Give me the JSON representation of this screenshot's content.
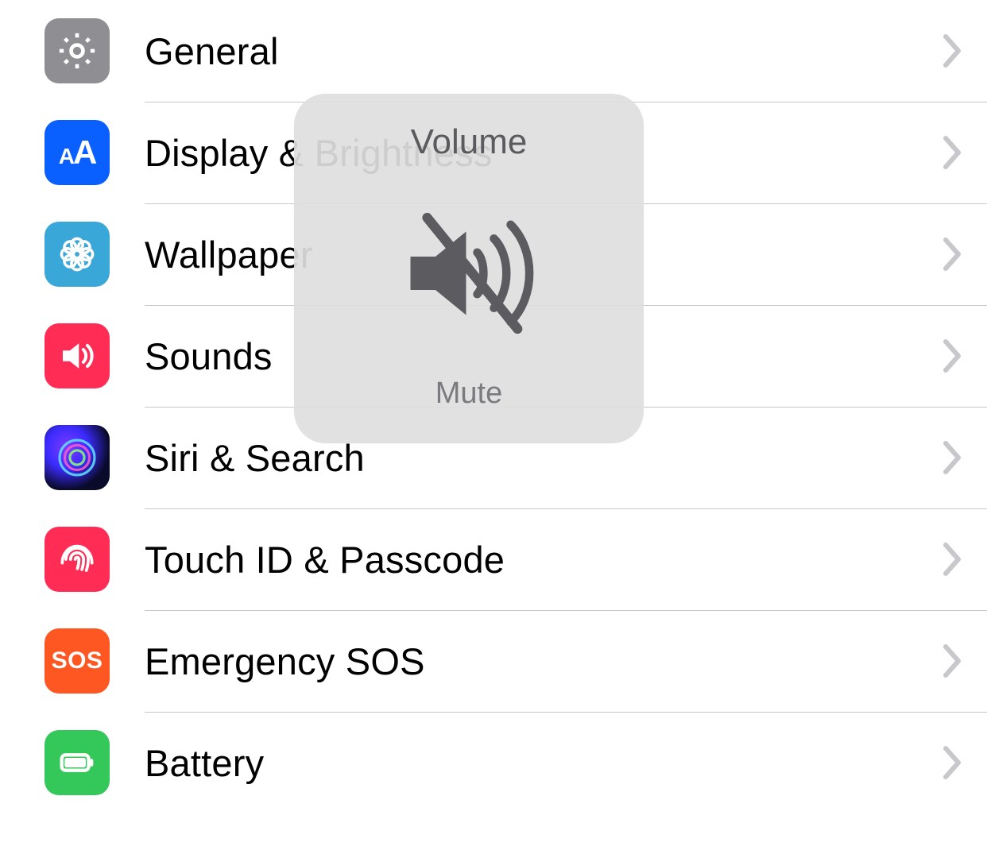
{
  "rows": [
    {
      "icon": "gear-icon",
      "label": "General"
    },
    {
      "icon": "text-size-icon",
      "label": "Display & Brightness"
    },
    {
      "icon": "flower-icon",
      "label": "Wallpaper"
    },
    {
      "icon": "speaker-icon",
      "label": "Sounds"
    },
    {
      "icon": "siri-icon",
      "label": "Siri & Search"
    },
    {
      "icon": "fingerprint-icon",
      "label": "Touch ID & Passcode"
    },
    {
      "icon": "sos-icon",
      "label": "Emergency SOS"
    },
    {
      "icon": "battery-icon",
      "label": "Battery"
    }
  ],
  "icon_text": {
    "aa_small": "A",
    "aa_big": "A",
    "sos": "SOS"
  },
  "hud": {
    "title": "Volume",
    "subtitle": "Mute"
  }
}
